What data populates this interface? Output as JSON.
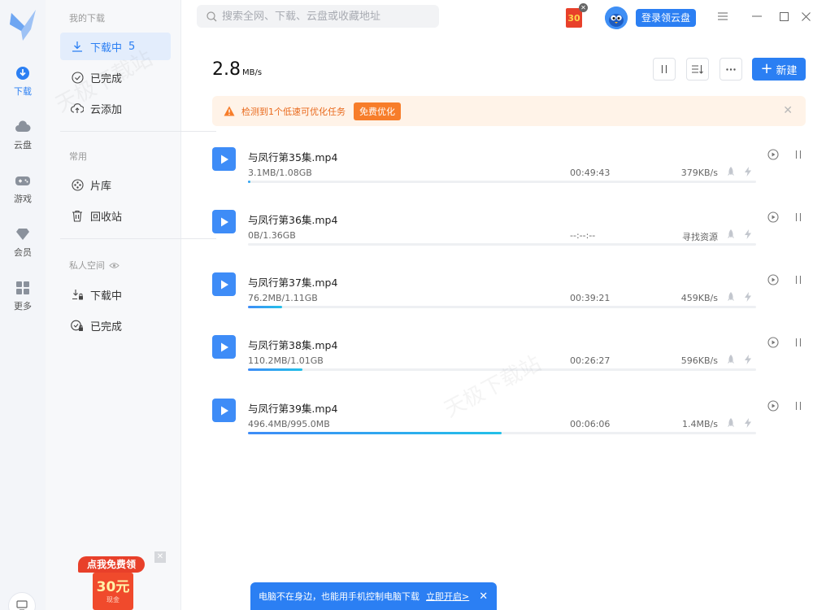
{
  "rail": {
    "items": [
      {
        "label": "下载",
        "icon": "download-icon"
      },
      {
        "label": "云盘",
        "icon": "cloud-icon"
      },
      {
        "label": "游戏",
        "icon": "gamepad-icon"
      },
      {
        "label": "会员",
        "icon": "diamond-icon"
      },
      {
        "label": "更多",
        "icon": "grid-icon"
      }
    ]
  },
  "sidebar": {
    "my_downloads": "我的下载",
    "downloading": "下载中",
    "downloading_count": "5",
    "completed": "已完成",
    "cloud_add": "云添加",
    "common": "常用",
    "library": "片库",
    "recycle": "回收站",
    "private_space": "私人空间",
    "private_downloading": "下载中",
    "private_completed": "已完成"
  },
  "promo": {
    "line1": "点我免费领",
    "amount": "30元",
    "line3": "现金"
  },
  "search": {
    "placeholder": "搜索全网、下载、云盘或收藏地址"
  },
  "header": {
    "badge": "30",
    "login": "登录领云盘"
  },
  "toolbar": {
    "speed": "2.8",
    "speed_unit": "MB/s",
    "new_label": "新建"
  },
  "alert": {
    "message": "检测到1个低速可优化任务",
    "action": "免费优化"
  },
  "tasks": [
    {
      "name": "与凤行第35集.mp4",
      "size": "3.1MB/1.08GB",
      "time": "00:49:43",
      "rate": "379KB/s",
      "progress": 0.003
    },
    {
      "name": "与凤行第36集.mp4",
      "size": "0B/1.36GB",
      "time": "--:--:--",
      "rate": "寻找资源",
      "progress": 0
    },
    {
      "name": "与凤行第37集.mp4",
      "size": "76.2MB/1.11GB",
      "time": "00:39:21",
      "rate": "459KB/s",
      "progress": 0.067
    },
    {
      "name": "与凤行第38集.mp4",
      "size": "110.2MB/1.01GB",
      "time": "00:26:27",
      "rate": "596KB/s",
      "progress": 0.107
    },
    {
      "name": "与凤行第39集.mp4",
      "size": "496.4MB/995.0MB",
      "time": "00:06:06",
      "rate": "1.4MB/s",
      "progress": 0.499
    }
  ],
  "notify": {
    "message": "电脑不在身边，也能用手机控制电脑下载",
    "link": "立即开启>"
  },
  "colors": {
    "accent": "#2b7ff3",
    "warning": "#f77d2a"
  }
}
